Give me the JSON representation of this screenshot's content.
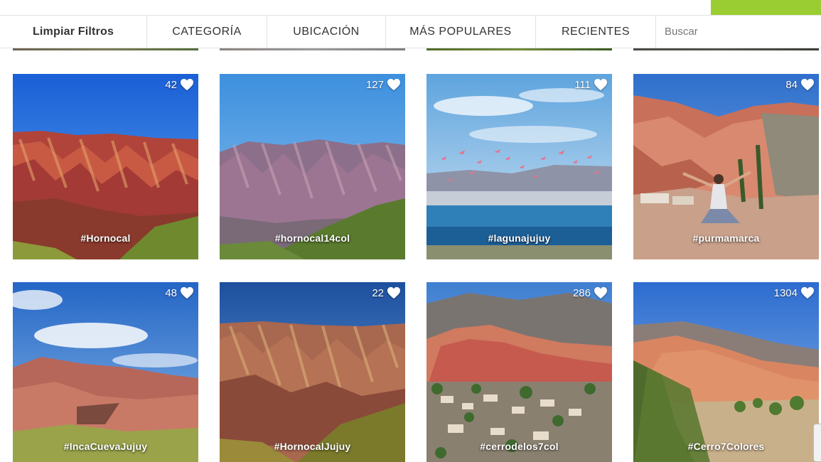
{
  "filters": {
    "clear": "Limpiar Filtros",
    "category": "CATEGORÍA",
    "location": "UBICACIÓN",
    "popular": "MÁS POPULARES",
    "recent": "RECIENTES"
  },
  "search": {
    "placeholder": "Buscar"
  },
  "colors": {
    "accent": "#9acd32",
    "heart": "#ffffff"
  },
  "gallery": [
    {
      "likes": "42",
      "tag": "#Hornocal"
    },
    {
      "likes": "127",
      "tag": "#hornocal14col"
    },
    {
      "likes": "111",
      "tag": "#lagunajujuy"
    },
    {
      "likes": "84",
      "tag": "#purmamarca"
    },
    {
      "likes": "48",
      "tag": "#IncaCuevaJujuy"
    },
    {
      "likes": "22",
      "tag": "#HornocalJujuy"
    },
    {
      "likes": "286",
      "tag": "#cerrodelos7col"
    },
    {
      "likes": "1304",
      "tag": "#Cerro7Colores"
    }
  ],
  "icons": {
    "like": "heart-icon"
  }
}
